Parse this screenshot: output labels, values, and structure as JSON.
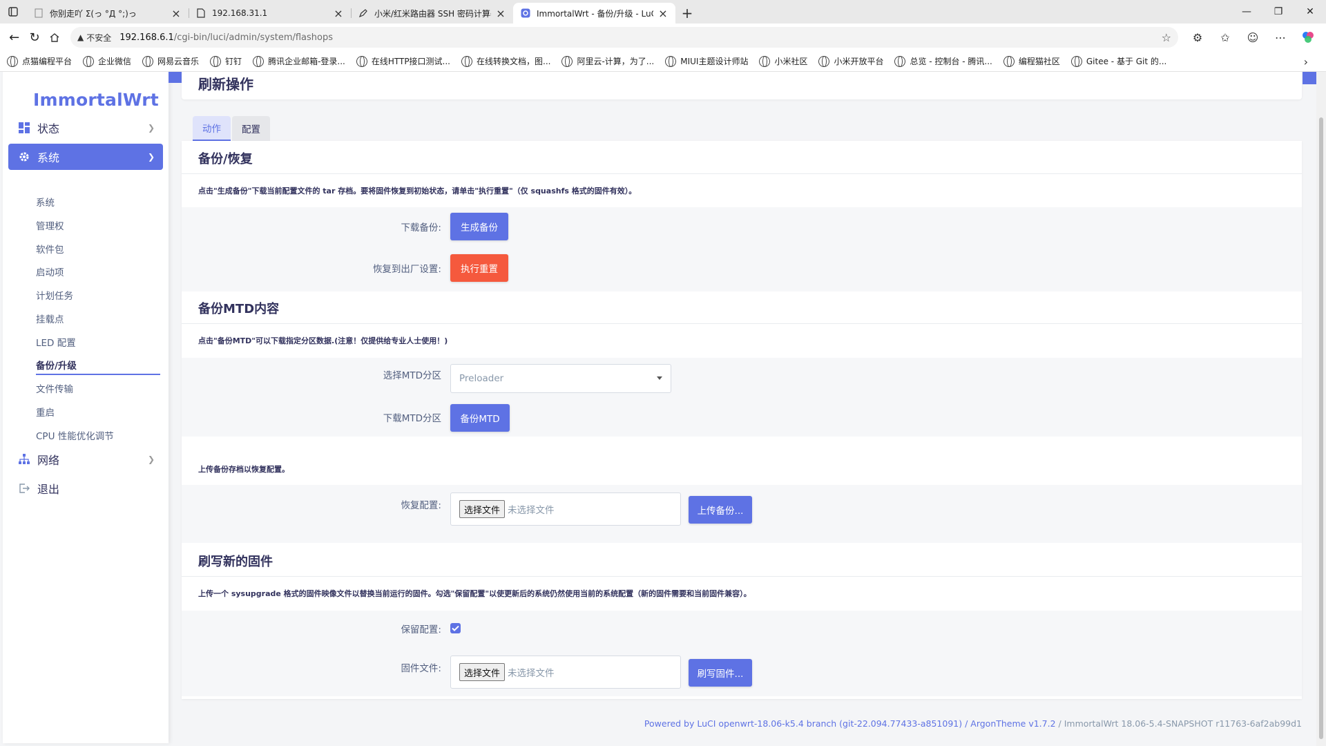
{
  "browser": {
    "tabs": [
      {
        "title": "你别走吖 Σ(っ °Д °;)っ",
        "active": false
      },
      {
        "title": "192.168.31.1",
        "active": false
      },
      {
        "title": "小米/红米路由器 SSH 密码计算器",
        "active": false
      },
      {
        "title": "ImmortalWrt - 备份/升级 - LuCI",
        "active": true
      }
    ],
    "insecure_label": "不安全",
    "url_host": "192.168.6.1",
    "url_path": "/cgi-bin/luci/admin/system/flashops",
    "bookmarks": [
      "点猫编程平台",
      "企业微信",
      "网易云音乐",
      "钉钉",
      "腾讯企业邮箱-登录...",
      "在线HTTP接口测试...",
      "在线转换文档，图...",
      "阿里云-计算，为了...",
      "MIUI主题设计师站",
      "小米社区",
      "小米开放平台",
      "总览 - 控制台 - 腾讯...",
      "编程猫社区",
      "Gitee - 基于 Git 的..."
    ]
  },
  "sidebar": {
    "logo": "ImmortalWrt",
    "menu": [
      {
        "label": "状态",
        "icon": "dashboard-icon"
      },
      {
        "label": "系统",
        "icon": "gear-icon"
      },
      {
        "label": "网络",
        "icon": "network-icon"
      },
      {
        "label": "退出",
        "icon": "logout-icon"
      }
    ],
    "system_items": [
      "系统",
      "管理权",
      "软件包",
      "启动项",
      "计划任务",
      "挂载点",
      "LED 配置",
      "备份/升级",
      "文件传输",
      "重启",
      "CPU 性能优化调节"
    ]
  },
  "page": {
    "title": "刷新操作",
    "tabs": [
      "动作",
      "配置"
    ],
    "backup": {
      "title": "备份/恢复",
      "desc": "点击\"生成备份\"下载当前配置文件的 tar 存档。要将固件恢复到初始状态，请单击\"执行重置\"（仅 squashfs 格式的固件有效）。",
      "download_label": "下载备份:",
      "download_btn": "生成备份",
      "reset_label": "恢复到出厂设置:",
      "reset_btn": "执行重置"
    },
    "mtd": {
      "title": "备份MTD内容",
      "desc": "点击\"备份MTD\"可以下载指定分区数据.(注意！仅提供给专业人士使用！)",
      "select_label": "选择MTD分区",
      "select_value": "Preloader",
      "download_label": "下载MTD分区",
      "download_btn": "备份MTD"
    },
    "restore": {
      "desc": "上传备份存档以恢复配置。",
      "label": "恢复配置:",
      "choose_btn": "选择文件",
      "no_file": "未选择文件",
      "upload_btn": "上传备份..."
    },
    "firmware": {
      "title": "刷写新的固件",
      "desc": "上传一个 sysupgrade 格式的固件映像文件以替换当前运行的固件。勾选\"保留配置\"以使更新后的系统仍然使用当前的系统配置（新的固件需要和当前固件兼容）。",
      "keep_label": "保留配置:",
      "keep_checked": true,
      "file_label": "固件文件:",
      "choose_btn": "选择文件",
      "no_file": "未选择文件",
      "flash_btn": "刷写固件..."
    },
    "footer": {
      "powered": "Powered by LuCI openwrt-18.06-k5.4 branch (git-22.094.77433-a851091) / ArgonTheme v1.7.2",
      "version": " / ImmortalWrt 18.06-5.4-SNAPSHOT r11763-6af2ab99d1"
    }
  },
  "colors": {
    "accent": "#5e72e4",
    "danger": "#f5593d"
  }
}
